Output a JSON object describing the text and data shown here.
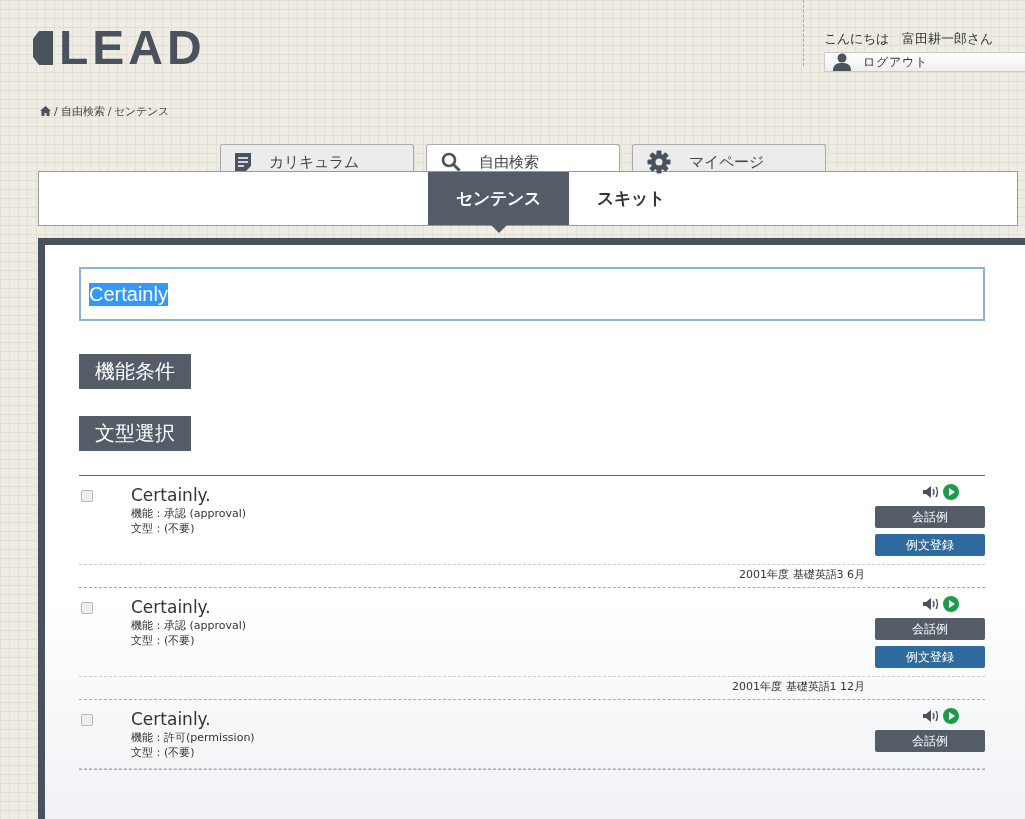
{
  "logo": {
    "text": "LEAD"
  },
  "user": {
    "greeting": "こんにちは　富田耕一郎さん",
    "logout": "ログアウト"
  },
  "breadcrumb": [
    "自由検索",
    "センテンス"
  ],
  "breadcrumb_separator": "/",
  "tabs": [
    {
      "label": "カリキュラム",
      "kind": "doc",
      "selected": false
    },
    {
      "label": "自由検索",
      "kind": "search",
      "selected": true
    },
    {
      "label": "マイページ",
      "kind": "gear",
      "selected": false
    }
  ],
  "subtabs": [
    {
      "label": "センテンス",
      "selected": true
    },
    {
      "label": "スキット",
      "selected": false
    }
  ],
  "search": {
    "value": "Certainly"
  },
  "filters": [
    "機能条件",
    "文型選択"
  ],
  "results": [
    {
      "checked": false,
      "sentence": "Certainly.",
      "function": "機能：承認 (approval)",
      "pattern": "文型：(不要)",
      "buttons": [
        {
          "label": "会話例",
          "kind": "dark"
        },
        {
          "label": "例文登録",
          "kind": "blue"
        }
      ],
      "source": "2001年度 基礎英語3 6月"
    },
    {
      "checked": false,
      "sentence": "Certainly.",
      "function": "機能：承認 (approval)",
      "pattern": "文型：(不要)",
      "buttons": [
        {
          "label": "会話例",
          "kind": "dark"
        },
        {
          "label": "例文登録",
          "kind": "blue"
        }
      ],
      "source": "2001年度 基礎英語1 12月"
    },
    {
      "checked": false,
      "sentence": "Certainly.",
      "function": "機能：許可(permission)",
      "pattern": "文型：(不要)",
      "buttons": [
        {
          "label": "会話例",
          "kind": "dark"
        }
      ]
    }
  ]
}
